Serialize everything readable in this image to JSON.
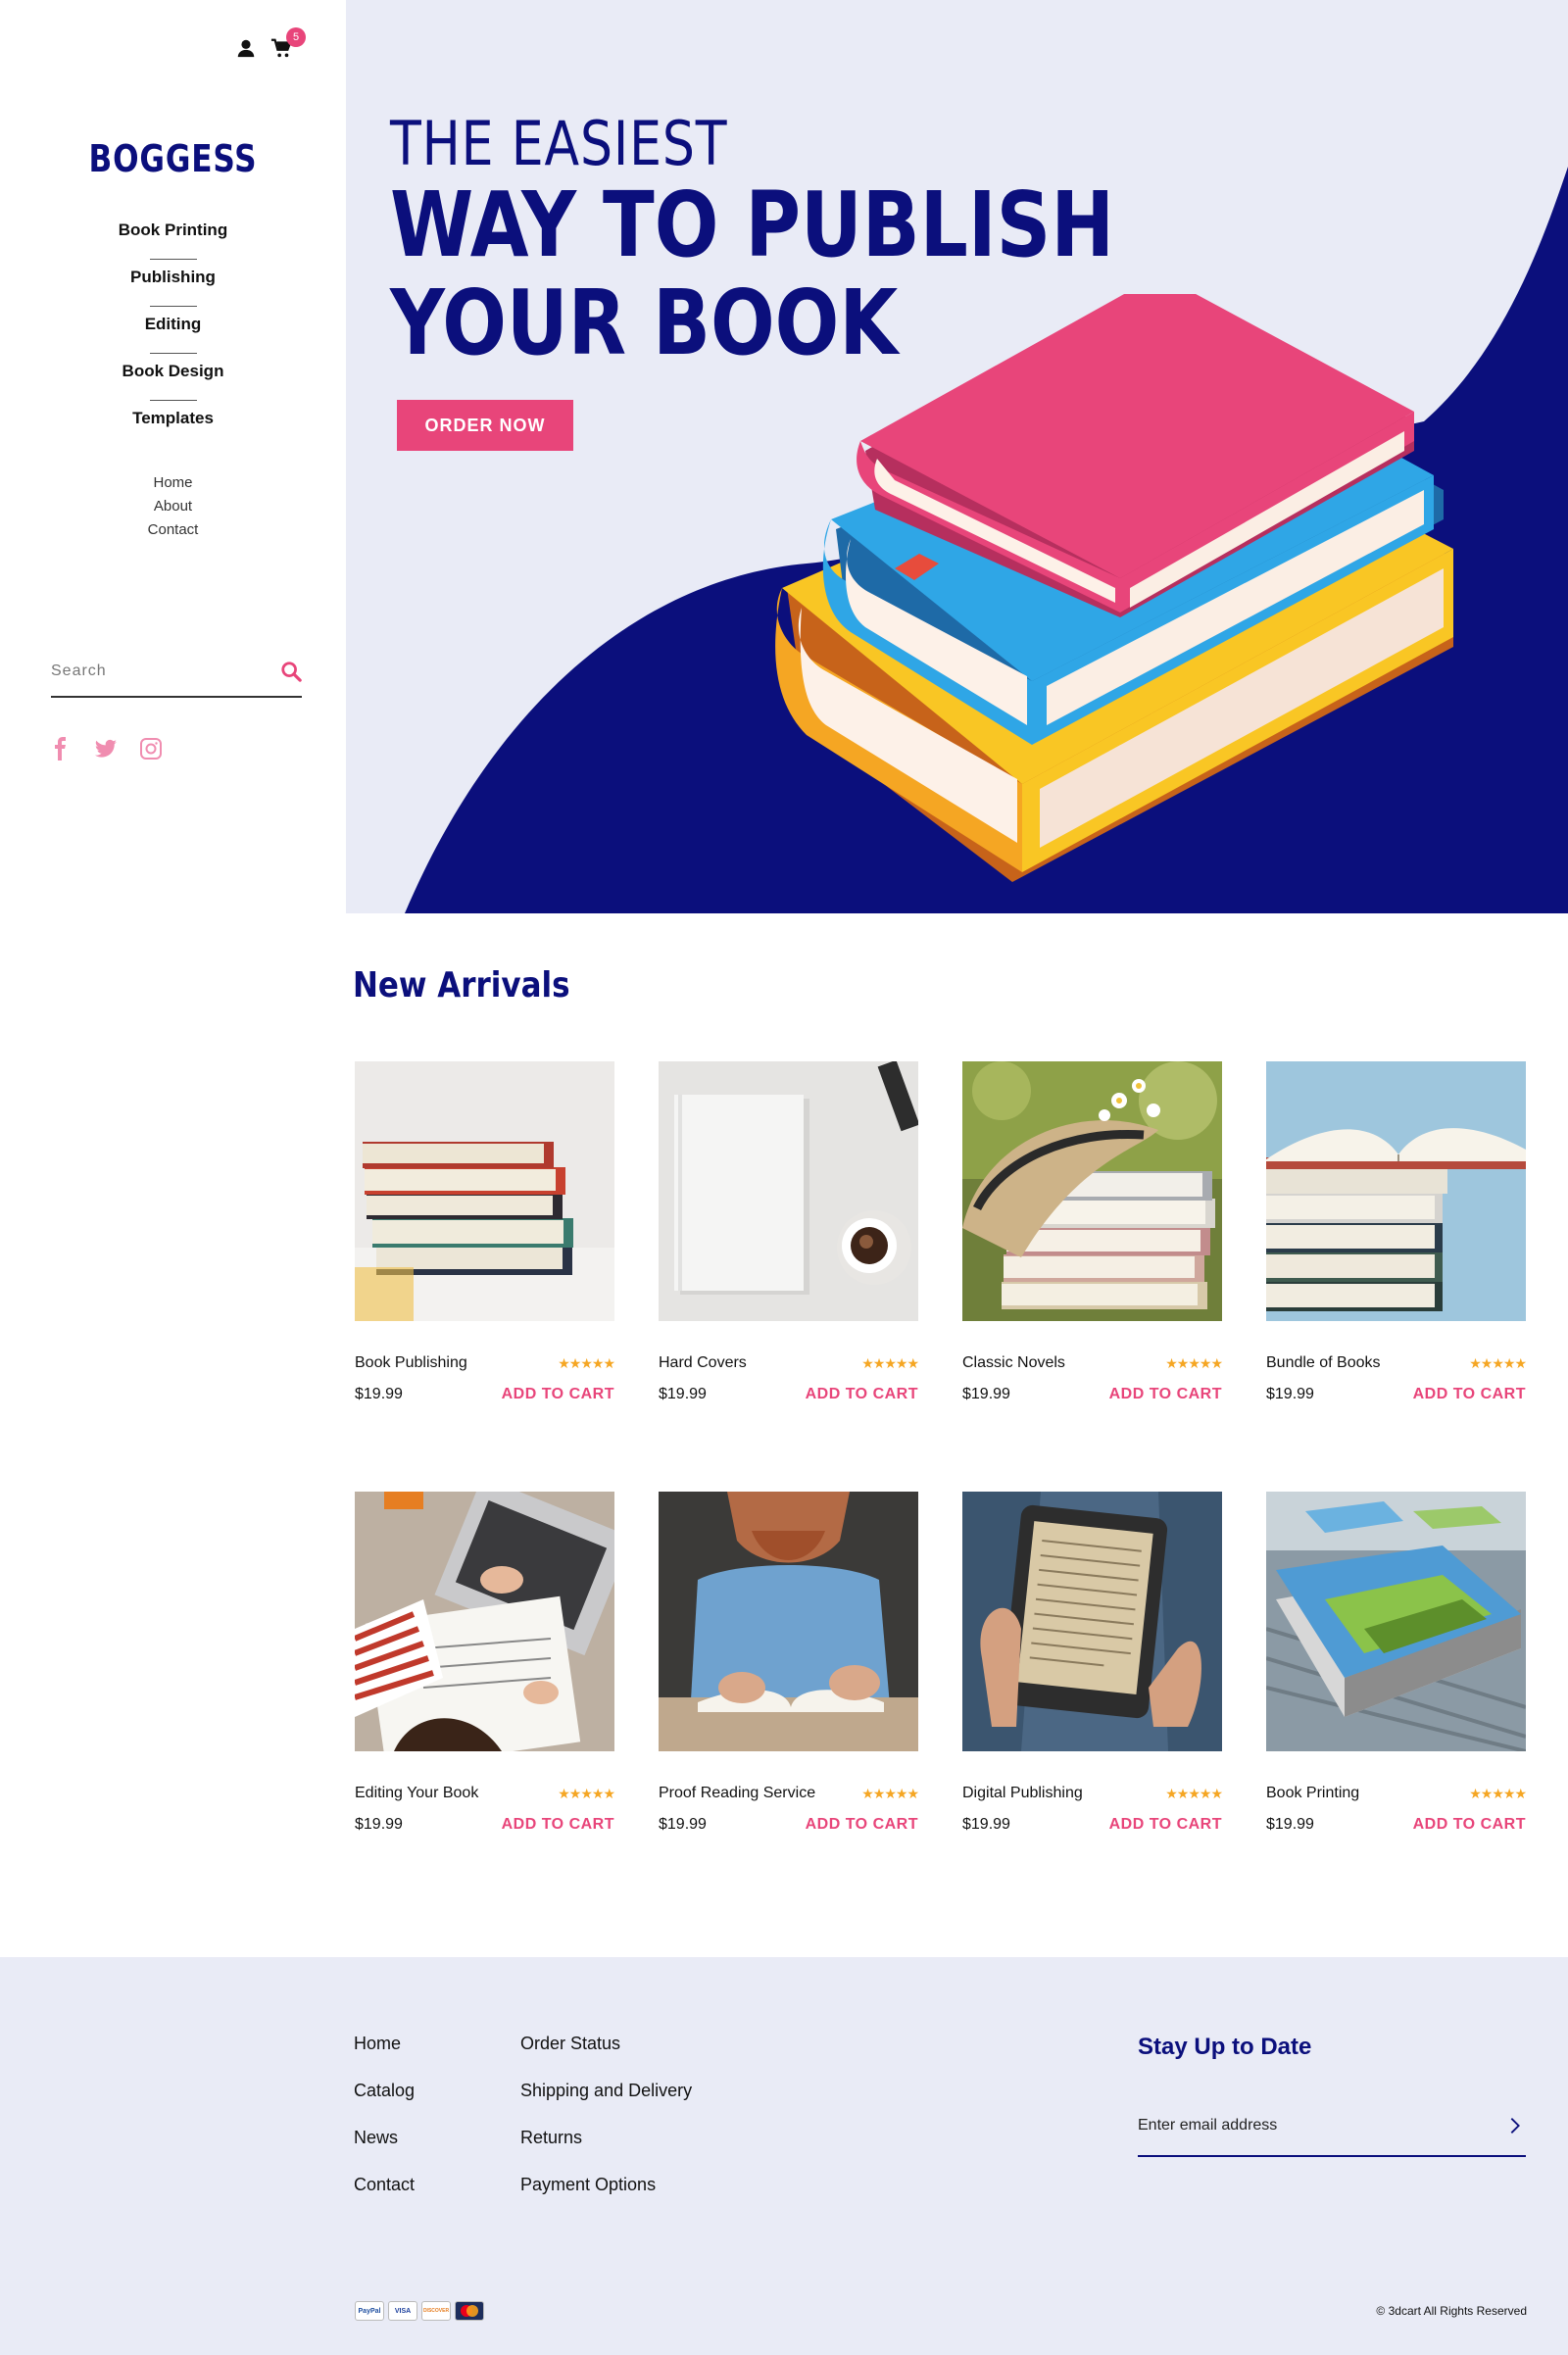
{
  "header": {
    "cart_count": "5",
    "logo": "BOGGESS"
  },
  "sidebar": {
    "main_nav": [
      {
        "label": "Book Printing"
      },
      {
        "label": "Publishing"
      },
      {
        "label": "Editing"
      },
      {
        "label": "Book Design"
      },
      {
        "label": "Templates"
      }
    ],
    "sub_nav": [
      {
        "label": "Home"
      },
      {
        "label": "About"
      },
      {
        "label": "Contact"
      }
    ],
    "search": {
      "placeholder": "Search"
    },
    "socials": [
      "facebook-icon",
      "twitter-icon",
      "instagram-icon"
    ]
  },
  "hero": {
    "pretitle": "THE EASIEST",
    "title_line1": "WAY TO PUBLISH",
    "title_line2": "YOUR BOOK",
    "cta": "ORDER NOW"
  },
  "products": {
    "title": "New Arrivals",
    "rating_stars": "★★★★★",
    "items": [
      {
        "name": "Book Publishing",
        "price": "$19.99",
        "cta": "ADD TO CART"
      },
      {
        "name": "Hard Covers",
        "price": "$19.99",
        "cta": "ADD TO CART"
      },
      {
        "name": "Classic Novels",
        "price": "$19.99",
        "cta": "ADD TO CART"
      },
      {
        "name": "Bundle of Books",
        "price": "$19.99",
        "cta": "ADD TO CART"
      },
      {
        "name": "Editing Your Book",
        "price": "$19.99",
        "cta": "ADD TO CART"
      },
      {
        "name": "Proof Reading Service",
        "price": "$19.99",
        "cta": "ADD TO CART"
      },
      {
        "name": "Digital Publishing",
        "price": "$19.99",
        "cta": "ADD TO CART"
      },
      {
        "name": "Book Printing",
        "price": "$19.99",
        "cta": "ADD TO CART"
      }
    ]
  },
  "footer": {
    "col1": [
      {
        "label": "Home"
      },
      {
        "label": "Catalog"
      },
      {
        "label": "News"
      },
      {
        "label": "Contact"
      }
    ],
    "col2": [
      {
        "label": "Order Status"
      },
      {
        "label": "Shipping and Delivery"
      },
      {
        "label": "Returns"
      },
      {
        "label": "Payment Options"
      }
    ],
    "newsletter_title": "Stay Up to Date",
    "email_placeholder": "Enter email address",
    "payments": [
      "PayPal",
      "VISA",
      "DISCOVER",
      "MC"
    ],
    "copyright": "© 3dcart All Rights Reserved"
  },
  "colors": {
    "brand_navy": "#0b0f7c",
    "accent_pink": "#e8457a",
    "star_gold": "#f5a623",
    "hero_bg": "#e9ebf6"
  }
}
